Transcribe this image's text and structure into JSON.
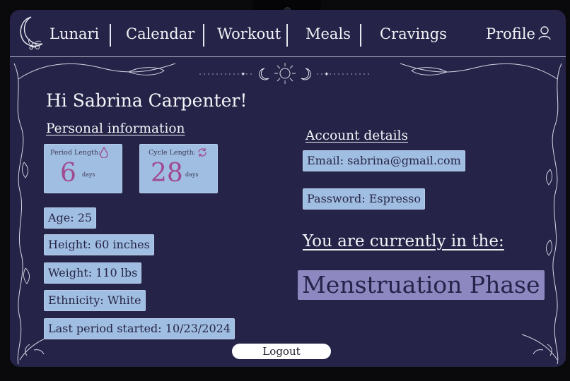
{
  "nav": {
    "brand": "Lunari",
    "items": [
      {
        "label": "Calendar"
      },
      {
        "label": "Workout"
      },
      {
        "label": "Meals"
      },
      {
        "label": "Cravings"
      }
    ],
    "profile": "Profile"
  },
  "greeting": "Hi Sabrina Carpenter!",
  "personal": {
    "title": "Personal information",
    "period": {
      "label": "Period Length:",
      "value": "6",
      "unit": "days",
      "icon": "droplet-icon"
    },
    "cycle": {
      "label": "Cycle Length:",
      "value": "28",
      "unit": "days",
      "icon": "cycle-refresh-icon"
    },
    "age": "Age: 25",
    "height": "Height: 60 inches",
    "weight": "Weight: 110 lbs",
    "ethnicity": "Ethnicity: White",
    "last_period": "Last period started: 10/23/2024"
  },
  "account": {
    "title": "Account details",
    "email": "Email: sabrina@gmail.com",
    "password": "Password: Espresso"
  },
  "phase": {
    "lead": "You are currently in the:",
    "name": "Menstruation Phase"
  },
  "logout": "Logout",
  "colors": {
    "background": "#252448",
    "card": "#a0bde2",
    "phase_box": "#8d88c0",
    "accent_number": "#a04a90"
  }
}
